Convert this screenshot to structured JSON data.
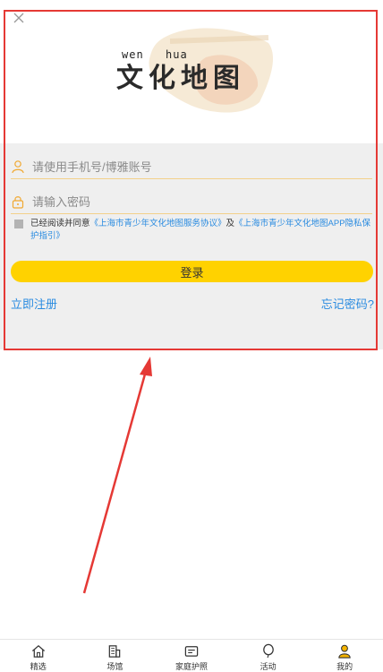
{
  "header": {
    "close_icon": "close-icon",
    "pinyin_left": "wen",
    "pinyin_right": "hua",
    "logo_title": "文化地图"
  },
  "login": {
    "account_placeholder": "请使用手机号/博雅账号",
    "password_placeholder": "请输入密码",
    "agree_prefix": "已经阅读并同意",
    "agreement_service": "《上海市青少年文化地图服务协议》",
    "agree_and": "及",
    "agreement_privacy": "《上海市青少年文化地图APP隐私保护指引》",
    "login_button": "登录",
    "register_link": "立即注册",
    "forgot_link": "忘记密码?"
  },
  "colors": {
    "accent": "#ffd200",
    "link": "#2a8be0",
    "annotation": "#e53935"
  },
  "tabbar": {
    "items": [
      {
        "label": "精选",
        "icon": "home-icon"
      },
      {
        "label": "场馆",
        "icon": "building-icon"
      },
      {
        "label": "家庭护照",
        "icon": "passport-icon"
      },
      {
        "label": "活动",
        "icon": "balloon-icon"
      },
      {
        "label": "我的",
        "icon": "user-icon"
      }
    ]
  }
}
